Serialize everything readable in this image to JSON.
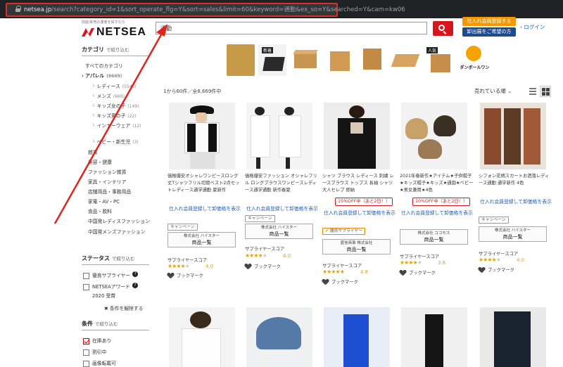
{
  "browser": {
    "url_domain": "netsea.jp",
    "url_path": "/search?category_id=1&sort_operate_flg=Y&sort=sales&limit=60&keyword=通勤&ex_so=Y&searched=Y&cam=kw06"
  },
  "header": {
    "tagline": "問屋/卸売の業者を探すなら",
    "logo": "NETSEA",
    "search_value": "通勤",
    "member_button": "仕入れ会員登録する",
    "wholesale_button": "卸出展をご希望の方",
    "login": "ログイン"
  },
  "sidebar": {
    "category_title": "カテゴリ",
    "category_hint": "で絞り込む",
    "all_categories": "すべてのカテゴリ",
    "apparel": {
      "label": "アパレル",
      "count": "(8669)"
    },
    "sub": [
      {
        "label": "レディース",
        "count": "(5545)"
      },
      {
        "label": "メンズ",
        "count": "(669)"
      },
      {
        "label": "キッズ女の子",
        "count": "(149)"
      },
      {
        "label": "キッズ男の子",
        "count": "(22)"
      },
      {
        "label": "インナーウェア",
        "count": "(12)"
      },
      {
        "label": "ベビー・新生児",
        "count": "(3)"
      }
    ],
    "top": [
      "雑貨",
      "美容・健康",
      "ファッション雑貨",
      "家具・インテリア",
      "店舗用品・事務用品",
      "家電・AV・PC",
      "食品・飲料",
      "中国発レディスファッション",
      "中国発メンズファッション"
    ],
    "status_title": "ステータス",
    "status_hint": "で絞り込む",
    "status_items": [
      "優良サプライヤー",
      "NETSEAアワード",
      "2020 受賞"
    ],
    "clear": "条件を解除する",
    "conditions_title": "条件",
    "conditions_hint": "で絞り込む",
    "conditions": [
      "在庫あり",
      "割引中",
      "画像転載可"
    ]
  },
  "results": {
    "count_text": "1から60件／全8,669件中",
    "sort": "売れている順"
  },
  "colors": {
    "accent_red": "#d8151b",
    "link_blue": "#1a5db5",
    "star": "#e7a100",
    "orange": "#f39800",
    "navy": "#1d4b8f"
  },
  "products": [
    {
      "name": "価格爆安オシャレワンピースロング丈Tシャツフリル切替ベスト2点セットレディース通学通勤 夏新作",
      "login_price": "仕入れ会員登録して卸価格を表示",
      "tag": "キャンペーン",
      "seller_type": "株式会社 ハイスター",
      "seller_btn": "商品一覧",
      "score_label": "サプライヤースコア",
      "score": "4.0",
      "stars": 4,
      "bookmark": "ブックマーク"
    },
    {
      "name": "価格爆安ファッション オシャレフリル ロングブラウスワンピースレディース通学通勤 新作春夏",
      "login_price": "仕入れ会員登録して卸価格を表示",
      "tag": "キャンペーン",
      "seller_type": "株式会社 ハイスター",
      "seller_btn": "商品一覧",
      "score_label": "サプライヤースコア",
      "score": "4.0",
      "stars": 4,
      "bookmark": "ブックマーク"
    },
    {
      "name": "シャツ ブラウス レディース 刺繍 レースブラウス トップス 長袖 シャツ 大人セレブ 即納",
      "promo": "15%OFF中（あと2日！）",
      "login_price": "仕入れ会員登録して卸価格を表示",
      "tag": "優良サプライヤー",
      "seller_type": "盛信商事 株式会社",
      "seller_btn": "商品一覧",
      "score_label": "サプライヤースコア",
      "score": "4.8",
      "stars": 5,
      "bookmark": "ブックマーク"
    },
    {
      "name": "2021年春新作★アイテム★子供帽子★キッズ帽子★キッズ★通園★ベビー★男女兼用★4色",
      "promo": "10%OFF中（あと2日！）",
      "login_price": "仕入れ会員登録して卸価格を表示",
      "seller_type": "株式会社 ココモス",
      "seller_btn": "商品一覧",
      "score_label": "サプライヤースコア",
      "score": "3.6",
      "stars": 4,
      "bookmark": "ブックマーク"
    },
    {
      "name": "シフォン花柄スカートお洒落レディース通勤 通学新作 4色",
      "login_price": "仕入れ会員登録して卸価格を表示",
      "tag": "キャンペーン",
      "seller_type": "株式会社 ハイスター",
      "seller_btn": "商品一覧",
      "score_label": "サプライヤースコア",
      "score": "4.0",
      "stars": 4,
      "bookmark": "ブックマーク"
    }
  ],
  "banner": {
    "label_new": "新着",
    "label_popular": "人気",
    "brand": "ダンボールワン"
  }
}
